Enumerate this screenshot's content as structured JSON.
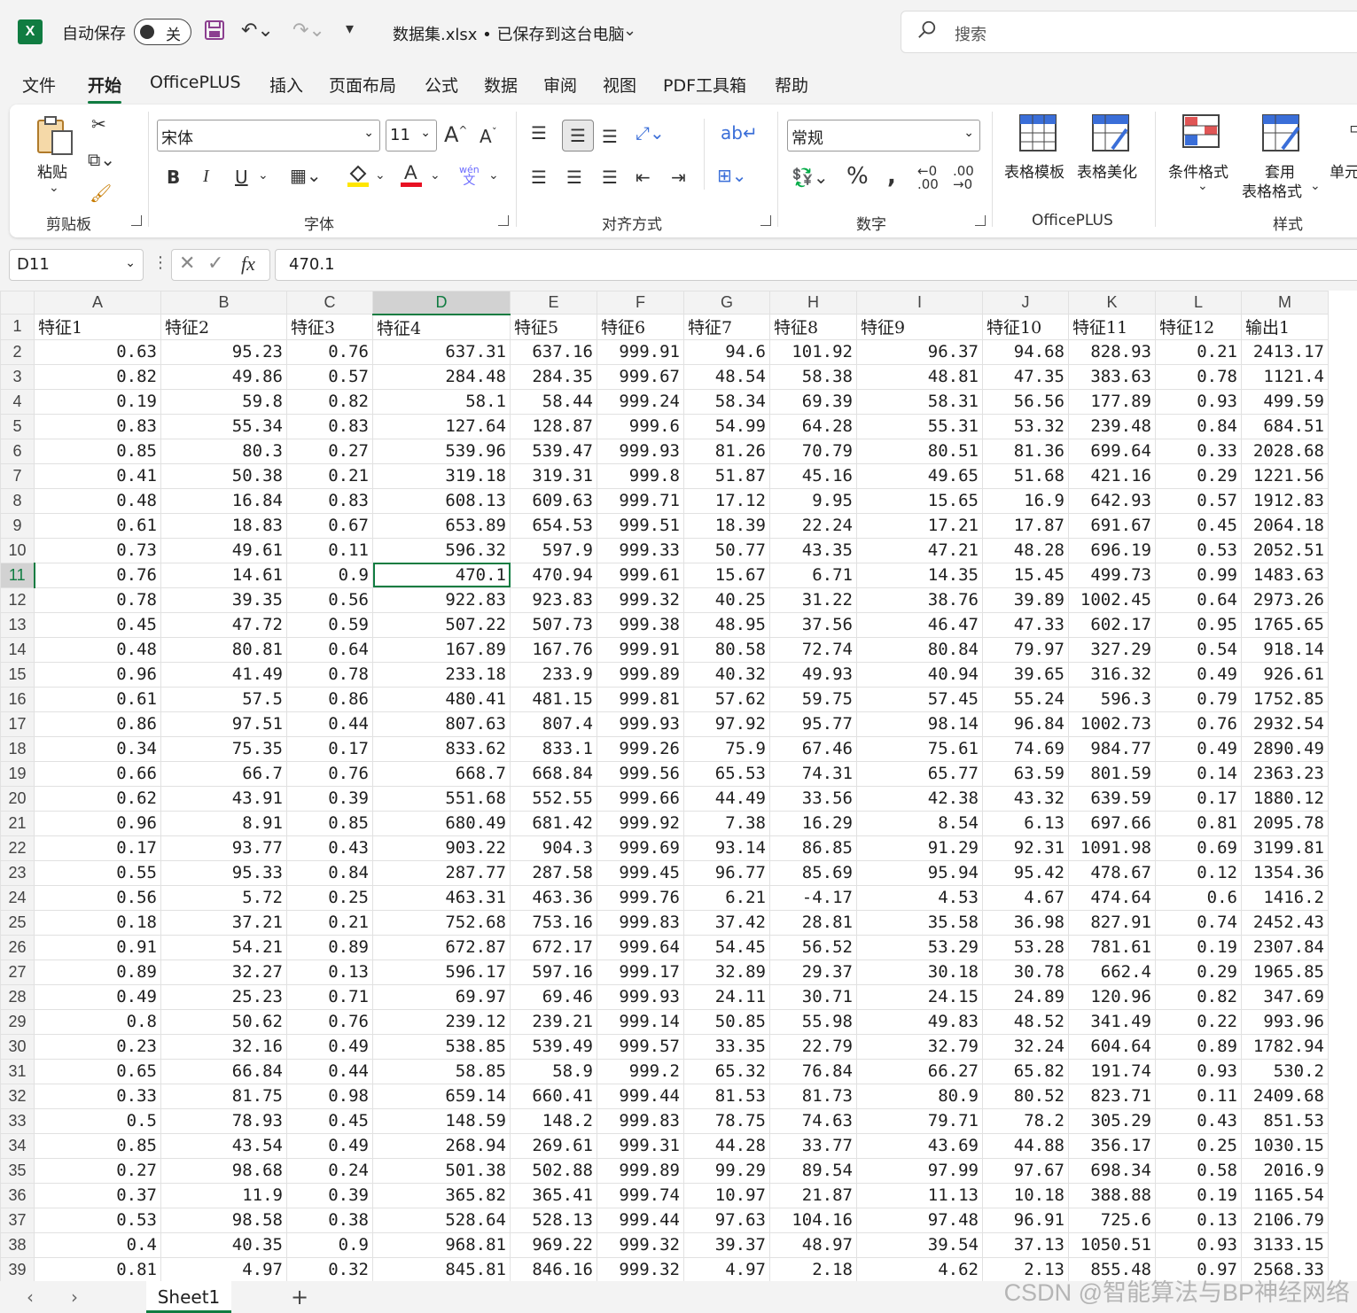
{
  "titlebar": {
    "autosave_label": "自动保存",
    "autosave_state": "关",
    "doc_title": "数据集.xlsx • 已保存到这台电脑",
    "search_placeholder": "搜索"
  },
  "menu": [
    "文件",
    "开始",
    "OfficePLUS",
    "插入",
    "页面布局",
    "公式",
    "数据",
    "审阅",
    "视图",
    "PDF工具箱",
    "帮助"
  ],
  "ribbon": {
    "paste": "粘贴",
    "clipboard": "剪贴板",
    "font_name": "宋体",
    "font_size": "11",
    "font": "字体",
    "align": "对齐方式",
    "number_format": "常规",
    "number": "数字",
    "table_template": "表格模板",
    "table_beautify": "表格美化",
    "officeplus": "OfficePLUS",
    "cond_format": "条件格式",
    "apply": "套用",
    "table_format": "表格格式",
    "cell": "单元",
    "styles": "样式",
    "bold": "B",
    "italic": "I",
    "underline": "U",
    "wen": "wén",
    "wen_char": "文"
  },
  "formula_bar": {
    "name_box": "D11",
    "fx": "fx",
    "value": "470.1"
  },
  "columns": [
    "A",
    "B",
    "C",
    "D",
    "E",
    "F",
    "G",
    "H",
    "I",
    "J",
    "K",
    "L",
    "M"
  ],
  "headers": [
    "特征1",
    "特征2",
    "特征3",
    "特征4",
    "特征5",
    "特征6",
    "特征7",
    "特征8",
    "特征9",
    "特征10",
    "特征11",
    "特征12",
    "输出1"
  ],
  "rows": [
    [
      "0.63",
      "95.23",
      "0.76",
      "637.31",
      "637.16",
      "999.91",
      "94.6",
      "101.92",
      "96.37",
      "94.68",
      "828.93",
      "0.21",
      "2413.17"
    ],
    [
      "0.82",
      "49.86",
      "0.57",
      "284.48",
      "284.35",
      "999.67",
      "48.54",
      "58.38",
      "48.81",
      "47.35",
      "383.63",
      "0.78",
      "1121.4"
    ],
    [
      "0.19",
      "59.8",
      "0.82",
      "58.1",
      "58.44",
      "999.24",
      "58.34",
      "69.39",
      "58.31",
      "56.56",
      "177.89",
      "0.93",
      "499.59"
    ],
    [
      "0.83",
      "55.34",
      "0.83",
      "127.64",
      "128.87",
      "999.6",
      "54.99",
      "64.28",
      "55.31",
      "53.32",
      "239.48",
      "0.84",
      "684.51"
    ],
    [
      "0.85",
      "80.3",
      "0.27",
      "539.96",
      "539.47",
      "999.93",
      "81.26",
      "70.79",
      "80.51",
      "81.36",
      "699.64",
      "0.33",
      "2028.68"
    ],
    [
      "0.41",
      "50.38",
      "0.21",
      "319.18",
      "319.31",
      "999.8",
      "51.87",
      "45.16",
      "49.65",
      "51.68",
      "421.16",
      "0.29",
      "1221.56"
    ],
    [
      "0.48",
      "16.84",
      "0.83",
      "608.13",
      "609.63",
      "999.71",
      "17.12",
      "9.95",
      "15.65",
      "16.9",
      "642.93",
      "0.57",
      "1912.83"
    ],
    [
      "0.61",
      "18.83",
      "0.67",
      "653.89",
      "654.53",
      "999.51",
      "18.39",
      "22.24",
      "17.21",
      "17.87",
      "691.67",
      "0.45",
      "2064.18"
    ],
    [
      "0.73",
      "49.61",
      "0.11",
      "596.32",
      "597.9",
      "999.33",
      "50.77",
      "43.35",
      "47.21",
      "48.28",
      "696.19",
      "0.53",
      "2052.51"
    ],
    [
      "0.76",
      "14.61",
      "0.9",
      "470.1",
      "470.94",
      "999.61",
      "15.67",
      "6.71",
      "14.35",
      "15.45",
      "499.73",
      "0.99",
      "1483.63"
    ],
    [
      "0.78",
      "39.35",
      "0.56",
      "922.83",
      "923.83",
      "999.32",
      "40.25",
      "31.22",
      "38.76",
      "39.89",
      "1002.45",
      "0.64",
      "2973.26"
    ],
    [
      "0.45",
      "47.72",
      "0.59",
      "507.22",
      "507.73",
      "999.38",
      "48.95",
      "37.56",
      "46.47",
      "47.33",
      "602.17",
      "0.95",
      "1765.65"
    ],
    [
      "0.48",
      "80.81",
      "0.64",
      "167.89",
      "167.76",
      "999.91",
      "80.58",
      "72.74",
      "80.84",
      "79.97",
      "327.29",
      "0.54",
      "918.14"
    ],
    [
      "0.96",
      "41.49",
      "0.78",
      "233.18",
      "233.9",
      "999.89",
      "40.32",
      "49.93",
      "40.94",
      "39.65",
      "316.32",
      "0.49",
      "926.61"
    ],
    [
      "0.61",
      "57.5",
      "0.86",
      "480.41",
      "481.15",
      "999.81",
      "57.62",
      "59.75",
      "57.45",
      "55.24",
      "596.3",
      "0.79",
      "1752.85"
    ],
    [
      "0.86",
      "97.51",
      "0.44",
      "807.63",
      "807.4",
      "999.93",
      "97.92",
      "95.77",
      "98.14",
      "96.84",
      "1002.73",
      "0.76",
      "2932.54"
    ],
    [
      "0.34",
      "75.35",
      "0.17",
      "833.62",
      "833.1",
      "999.26",
      "75.9",
      "67.46",
      "75.61",
      "74.69",
      "984.77",
      "0.49",
      "2890.49"
    ],
    [
      "0.66",
      "66.7",
      "0.76",
      "668.7",
      "668.84",
      "999.56",
      "65.53",
      "74.31",
      "65.77",
      "63.59",
      "801.59",
      "0.14",
      "2363.23"
    ],
    [
      "0.62",
      "43.91",
      "0.39",
      "551.68",
      "552.55",
      "999.66",
      "44.49",
      "33.56",
      "42.38",
      "43.32",
      "639.59",
      "0.17",
      "1880.12"
    ],
    [
      "0.96",
      "8.91",
      "0.85",
      "680.49",
      "681.42",
      "999.92",
      "7.38",
      "16.29",
      "8.54",
      "6.13",
      "697.66",
      "0.81",
      "2095.78"
    ],
    [
      "0.17",
      "93.77",
      "0.43",
      "903.22",
      "904.3",
      "999.69",
      "93.14",
      "86.85",
      "91.29",
      "92.31",
      "1091.98",
      "0.69",
      "3199.81"
    ],
    [
      "0.55",
      "95.33",
      "0.84",
      "287.77",
      "287.58",
      "999.45",
      "96.77",
      "85.69",
      "95.94",
      "95.42",
      "478.67",
      "0.12",
      "1354.36"
    ],
    [
      "0.56",
      "5.72",
      "0.25",
      "463.31",
      "463.36",
      "999.76",
      "6.21",
      "-4.17",
      "4.53",
      "4.67",
      "474.64",
      "0.6",
      "1416.2"
    ],
    [
      "0.18",
      "37.21",
      "0.21",
      "752.68",
      "753.16",
      "999.83",
      "37.42",
      "28.81",
      "35.58",
      "36.98",
      "827.91",
      "0.74",
      "2452.43"
    ],
    [
      "0.91",
      "54.21",
      "0.89",
      "672.87",
      "672.17",
      "999.64",
      "54.45",
      "56.52",
      "53.29",
      "53.28",
      "781.61",
      "0.19",
      "2307.84"
    ],
    [
      "0.89",
      "32.27",
      "0.13",
      "596.17",
      "597.16",
      "999.17",
      "32.89",
      "29.37",
      "30.18",
      "30.78",
      "662.4",
      "0.29",
      "1965.85"
    ],
    [
      "0.49",
      "25.23",
      "0.71",
      "69.97",
      "69.46",
      "999.93",
      "24.11",
      "30.71",
      "24.15",
      "24.89",
      "120.96",
      "0.82",
      "347.69"
    ],
    [
      "0.8",
      "50.62",
      "0.76",
      "239.12",
      "239.21",
      "999.14",
      "50.85",
      "55.98",
      "49.83",
      "48.52",
      "341.49",
      "0.22",
      "993.96"
    ],
    [
      "0.23",
      "32.16",
      "0.49",
      "538.85",
      "539.49",
      "999.57",
      "33.35",
      "22.79",
      "32.79",
      "32.24",
      "604.64",
      "0.89",
      "1782.94"
    ],
    [
      "0.65",
      "66.84",
      "0.44",
      "58.85",
      "58.9",
      "999.2",
      "65.32",
      "76.84",
      "66.27",
      "65.82",
      "191.74",
      "0.93",
      "530.2"
    ],
    [
      "0.33",
      "81.75",
      "0.98",
      "659.14",
      "660.41",
      "999.44",
      "81.53",
      "81.73",
      "80.9",
      "80.52",
      "823.71",
      "0.11",
      "2409.68"
    ],
    [
      "0.5",
      "78.93",
      "0.45",
      "148.59",
      "148.2",
      "999.83",
      "78.75",
      "74.63",
      "79.71",
      "78.2",
      "305.29",
      "0.43",
      "851.53"
    ],
    [
      "0.85",
      "43.54",
      "0.49",
      "268.94",
      "269.61",
      "999.31",
      "44.28",
      "33.77",
      "43.69",
      "44.88",
      "356.17",
      "0.25",
      "1030.15"
    ],
    [
      "0.27",
      "98.68",
      "0.24",
      "501.38",
      "502.88",
      "999.89",
      "99.29",
      "89.54",
      "97.99",
      "97.67",
      "698.34",
      "0.58",
      "2016.9"
    ],
    [
      "0.37",
      "11.9",
      "0.39",
      "365.82",
      "365.41",
      "999.74",
      "10.97",
      "21.87",
      "11.13",
      "10.18",
      "388.88",
      "0.19",
      "1165.54"
    ],
    [
      "0.53",
      "98.58",
      "0.38",
      "528.64",
      "528.13",
      "999.44",
      "97.63",
      "104.16",
      "97.48",
      "96.91",
      "725.6",
      "0.13",
      "2106.79"
    ],
    [
      "0.4",
      "40.35",
      "0.9",
      "968.81",
      "969.22",
      "999.32",
      "39.37",
      "48.97",
      "39.54",
      "37.13",
      "1050.51",
      "0.93",
      "3133.15"
    ],
    [
      "0.81",
      "4.97",
      "0.32",
      "845.81",
      "846.16",
      "999.32",
      "4.97",
      "2.18",
      "4.62",
      "2.13",
      "855.48",
      "0.97",
      "2568.33"
    ]
  ],
  "sheet_tab": "Sheet1",
  "watermark": "CSDN @智能算法与BP神经网络"
}
